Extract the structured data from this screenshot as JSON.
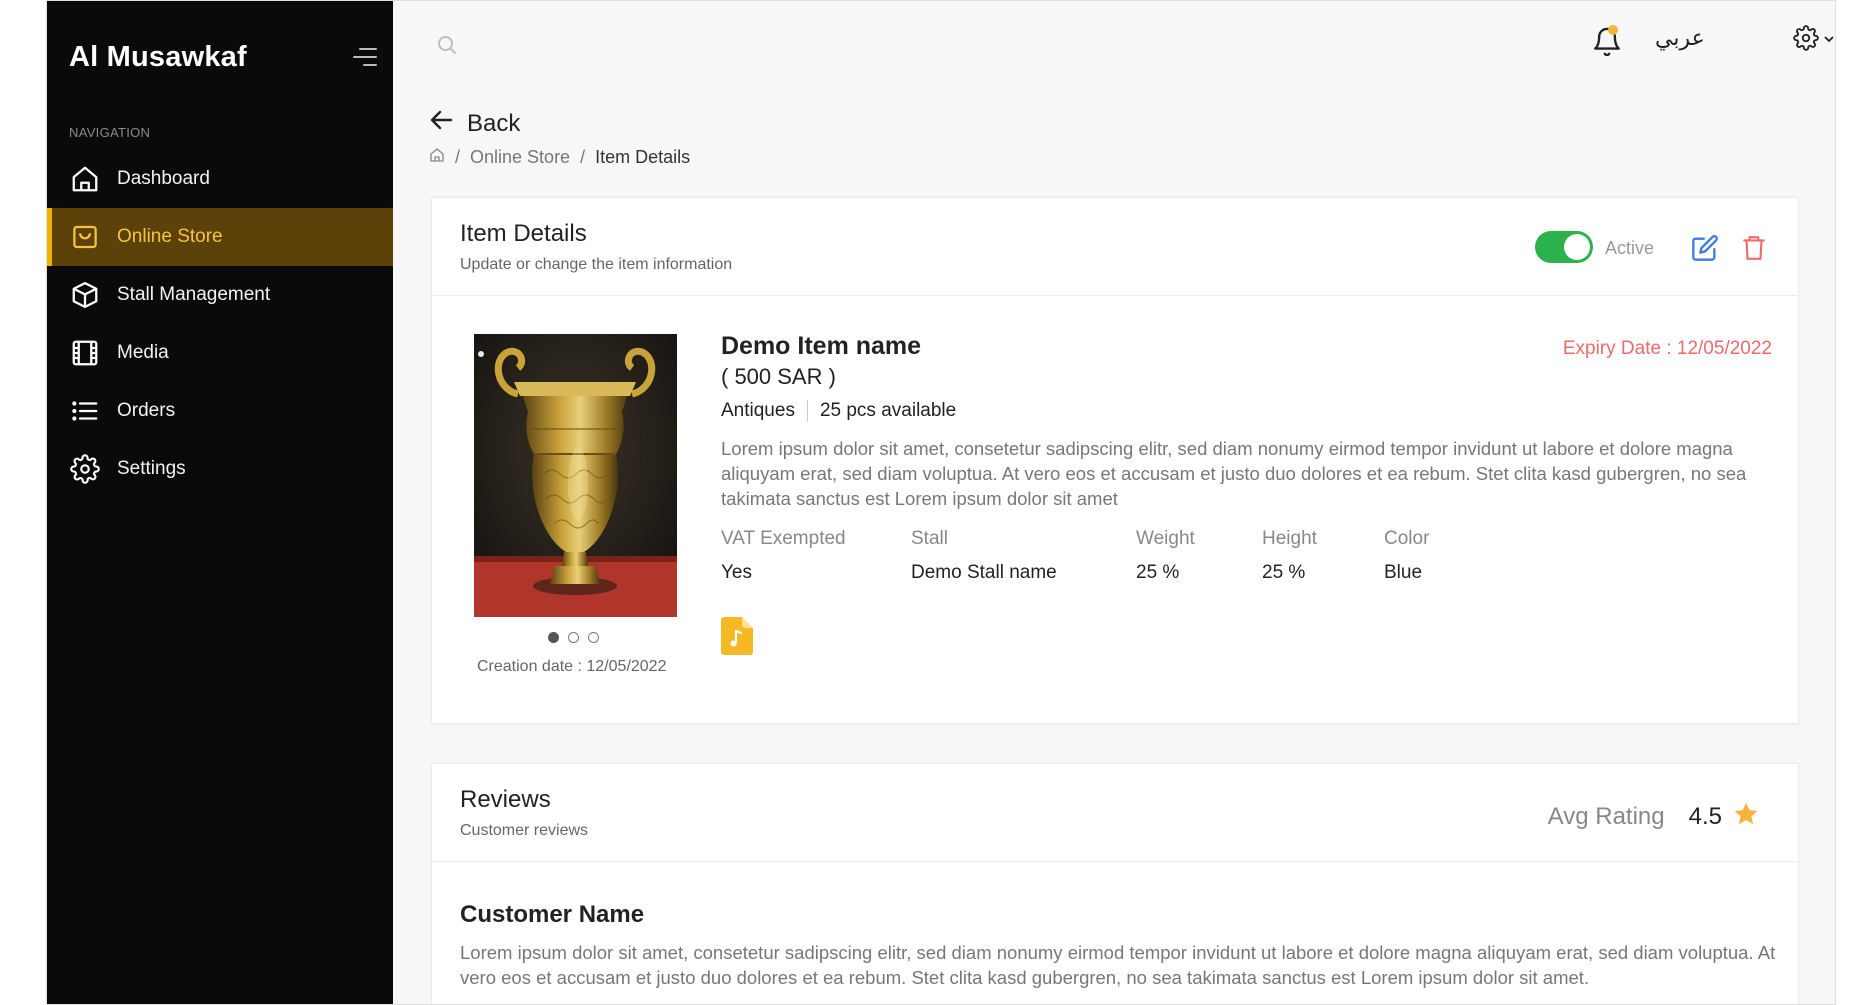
{
  "app": {
    "brand": "Al Musawkaf"
  },
  "sidebar": {
    "section_title": "NAVIGATION",
    "items": [
      {
        "label": "Dashboard",
        "icon": "home-icon",
        "active": false
      },
      {
        "label": "Online Store",
        "icon": "shopping-bag-icon",
        "active": true
      },
      {
        "label": "Stall Management",
        "icon": "cube-icon",
        "active": false
      },
      {
        "label": "Media",
        "icon": "film-icon",
        "active": false
      },
      {
        "label": "Orders",
        "icon": "list-icon",
        "active": false
      },
      {
        "label": "Settings",
        "icon": "gear-icon",
        "active": false
      }
    ]
  },
  "topbar": {
    "search_icon": "search-icon",
    "notification_icon": "bell-icon",
    "language": "عربي",
    "settings_icon": "gear-icon"
  },
  "page": {
    "back_label": "Back",
    "breadcrumb": [
      "Online Store",
      "Item Details"
    ]
  },
  "details": {
    "title": "Item Details",
    "subtitle": "Update or change the item information",
    "status_label": "Active",
    "status_on": true,
    "item_name": "Demo Item name",
    "price": "( 500 SAR )",
    "category": "Antiques",
    "availability": "25 pcs available",
    "expiry": "Expiry Date : 12/05/2022",
    "description": "Lorem ipsum dolor sit amet, consetetur sadipscing elitr, sed diam nonumy eirmod tempor invidunt ut labore et dolore magna aliquyam erat, sed diam voluptua. At vero eos et accusam et justo duo dolores et ea rebum. Stet clita kasd gubergren, no sea takimata sanctus est Lorem ipsum dolor sit amet",
    "specs": [
      {
        "label": "VAT Exempted",
        "value": "Yes"
      },
      {
        "label": "Stall",
        "value": "Demo Stall name"
      },
      {
        "label": "Weight",
        "value": "25 %"
      },
      {
        "label": "Height",
        "value": "25 %"
      },
      {
        "label": "Color",
        "value": "Blue"
      }
    ],
    "creation_date": "Creation date : 12/05/2022",
    "image_count": 3,
    "image_active": 1
  },
  "reviews": {
    "title": "Reviews",
    "subtitle": "Customer reviews",
    "avg_label": "Avg Rating",
    "avg_value": "4.5",
    "items": [
      {
        "name": "Customer Name",
        "text": "Lorem ipsum dolor sit amet, consetetur sadipscing elitr, sed diam nonumy eirmod tempor invidunt ut labore et dolore magna aliquyam erat, sed diam voluptua. At vero eos et accusam et justo duo dolores et ea rebum. Stet clita kasd gubergren, no sea takimata sanctus est Lorem ipsum dolor sit amet."
      }
    ]
  },
  "colors": {
    "sidebar_bg": "#0a0a0a",
    "active_bg": "#5c4208",
    "active_text": "#f6c243",
    "toggle_on": "#2bb24c",
    "danger": "#ee6b6b",
    "edit": "#3b7ddd",
    "star": "#f6b23a"
  }
}
